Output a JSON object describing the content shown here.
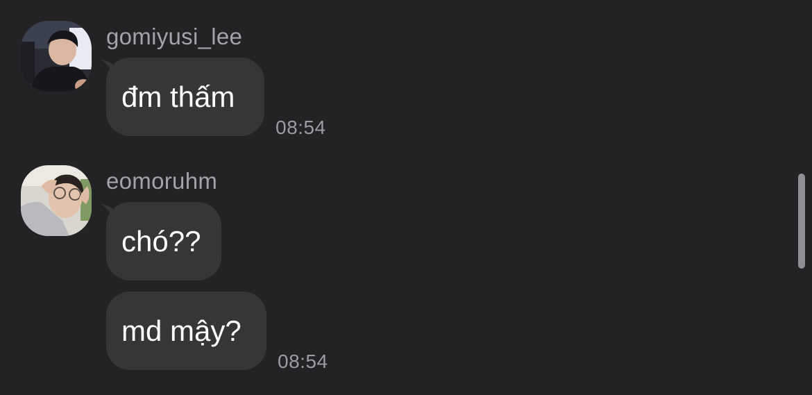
{
  "messages": [
    {
      "username": "gomiyusi_lee",
      "avatar": "avatar-user-photo-dark",
      "bubbles": [
        "đm thấm"
      ],
      "time": "08:54"
    },
    {
      "username": "eomoruhm",
      "avatar": "avatar-user-photo-light",
      "bubbles": [
        "chó??",
        "md mậy?"
      ],
      "time": "08:54"
    }
  ],
  "colors": {
    "background": "#232325",
    "bubble": "#363638",
    "username": "#a3a3a8",
    "timestamp": "#9c9ca1",
    "text": "#ffffff"
  }
}
